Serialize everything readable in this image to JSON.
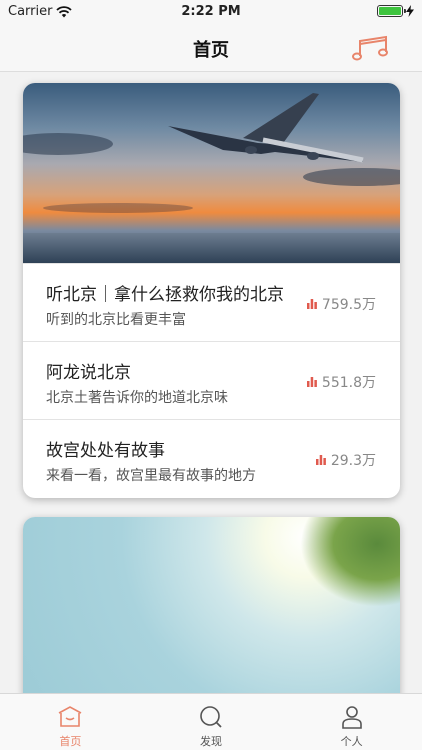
{
  "status_bar": {
    "carrier": "Carrier",
    "time": "2:22 PM"
  },
  "nav": {
    "title": "首页",
    "right_icon": "music-note-icon",
    "accent": "#e8846a"
  },
  "cards": [
    {
      "banner": "airplane-sunset-image",
      "items": [
        {
          "title": "听北京｜拿什么拯救你我的北京",
          "subtitle": "听到的北京比看更丰富",
          "plays": "759.5万"
        },
        {
          "title": "阿龙说北京",
          "subtitle": "北京土著告诉你的地道北京味",
          "plays": "551.8万"
        },
        {
          "title": "故宫处处有故事",
          "subtitle": "来看一看，故宫里最有故事的地方",
          "plays": "29.3万"
        }
      ]
    },
    {
      "banner": "beach-sunlight-image"
    }
  ],
  "tabs": [
    {
      "label": "首页",
      "icon": "home-icon",
      "active": true
    },
    {
      "label": "发现",
      "icon": "search-icon",
      "active": false
    },
    {
      "label": "个人",
      "icon": "person-icon",
      "active": false
    }
  ],
  "colors": {
    "stat_icon": "#e05a4e",
    "tab_active": "#e8846a"
  }
}
